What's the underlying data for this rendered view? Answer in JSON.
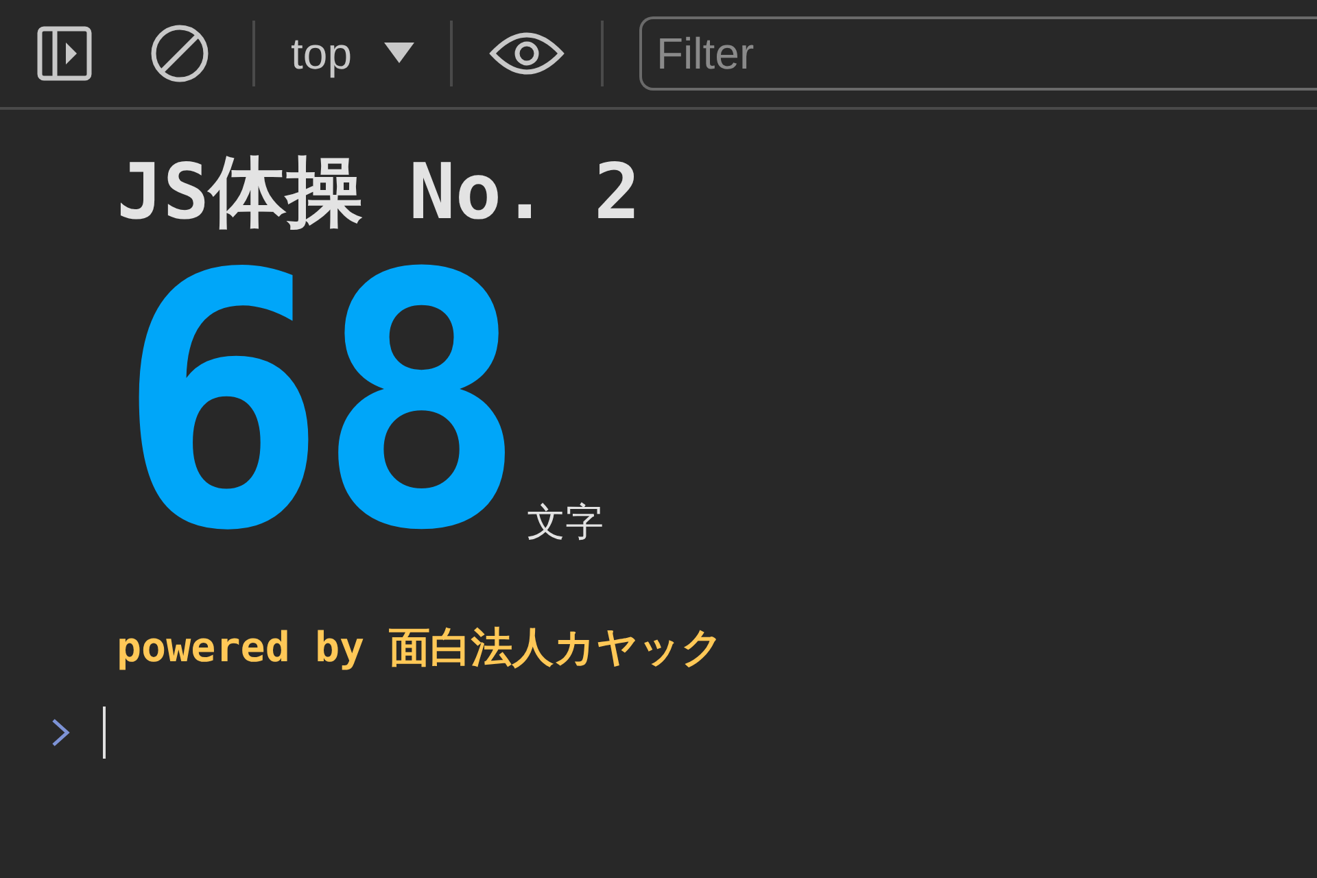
{
  "toolbar": {
    "context": "top",
    "filter": {
      "placeholder": "Filter"
    }
  },
  "output": {
    "title": "JS体操 No. 2",
    "count": "68",
    "unit": "文字",
    "credit": "powered by 面白法人カヤック"
  }
}
